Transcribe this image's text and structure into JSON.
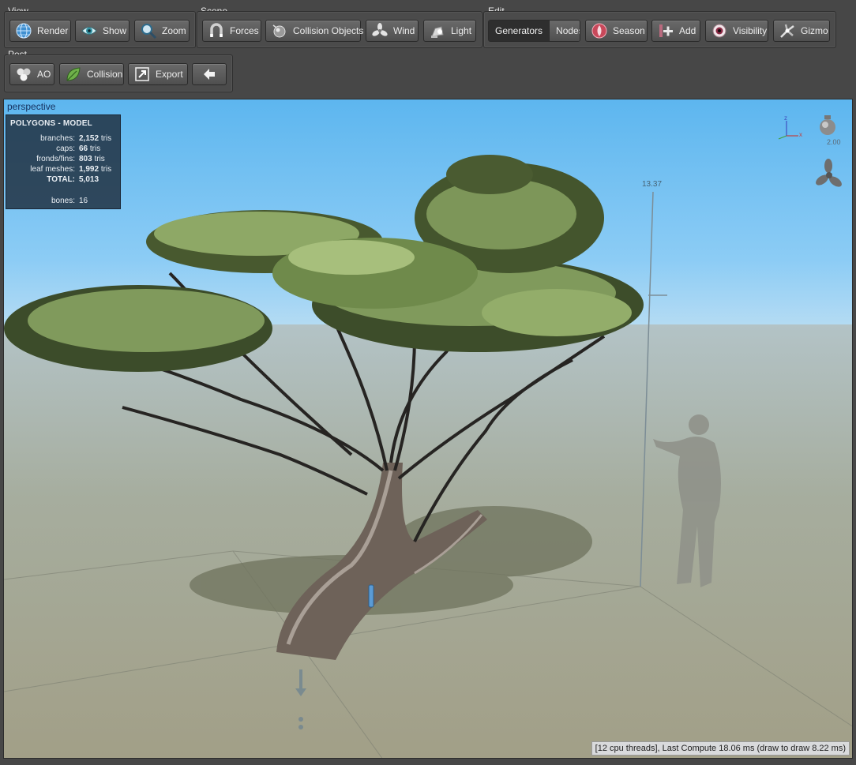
{
  "toolbar": {
    "view": {
      "label": "View",
      "buttons": {
        "render": "Render",
        "show": "Show",
        "zoom": "Zoom"
      }
    },
    "scene": {
      "label": "Scene",
      "buttons": {
        "forces": "Forces",
        "collision_objects": "Collision Objects",
        "wind": "Wind",
        "light": "Light"
      }
    },
    "edit": {
      "label": "Edit",
      "segmented": {
        "generators": "Generators",
        "nodes": "Nodes",
        "selected": "Generators"
      },
      "buttons": {
        "season": "Season",
        "add": "Add",
        "visibility": "Visibility",
        "gizmo": "Gizmo"
      }
    },
    "post": {
      "label": "Post",
      "buttons": {
        "ao": "AO",
        "collision": "Collision",
        "export": "Export"
      }
    }
  },
  "viewport": {
    "camera_label": "perspective",
    "stats": {
      "title": "POLYGONS - MODEL",
      "rows": [
        {
          "key": "branches:",
          "value": "2,152",
          "unit": "tris"
        },
        {
          "key": "caps:",
          "value": "66",
          "unit": "tris"
        },
        {
          "key": "fronds/fins:",
          "value": "803",
          "unit": "tris"
        },
        {
          "key": "leaf meshes:",
          "value": "1,992",
          "unit": "tris"
        },
        {
          "key": "TOTAL:",
          "value": "5,013",
          "unit": ""
        },
        {
          "key": "bones:",
          "value": "16",
          "unit": ""
        }
      ]
    },
    "height_ruler_value": "13.37",
    "light_intensity": "2.00",
    "axis_labels": {
      "x": "x",
      "z": "z"
    },
    "status": "[12 cpu threads], Last Compute 18.06 ms (draw to draw 8.22 ms)"
  },
  "colors": {
    "toolbar_bg": "#474747",
    "sky_top": "#5db6ef",
    "ground": "#a6ad9e",
    "stats_bg": "#213142",
    "selected_segment": "#2e2e2e"
  },
  "icons": {
    "render": "globe-icon",
    "show": "eye-icon",
    "zoom": "magnifier-icon",
    "forces": "magnet-icon",
    "collision_objects": "sphere-icon",
    "wind": "fan-icon",
    "light": "lamp-icon",
    "season": "season-icon",
    "add": "add-node-icon",
    "visibility": "eyeball-icon",
    "gizmo": "gizmo-icon",
    "ao": "ao-spheres-icon",
    "collision": "leaf-icon",
    "export": "export-icon",
    "back": "back-arrow-icon"
  }
}
